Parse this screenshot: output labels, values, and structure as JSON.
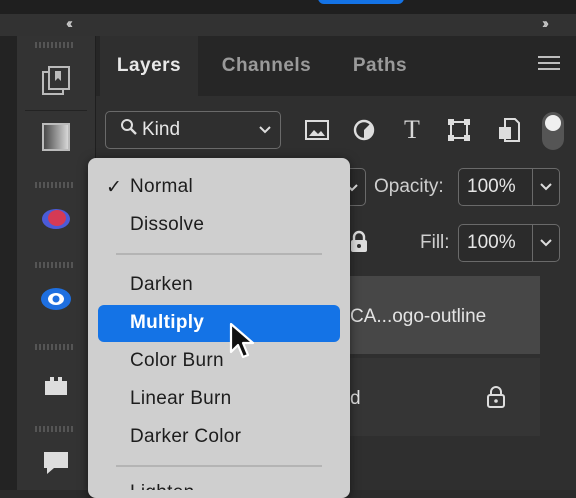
{
  "panel": {
    "collapse_left": "‹‹",
    "collapse_right": "››",
    "tabs": [
      "Layers",
      "Channels",
      "Paths"
    ],
    "active_tab": "Layers"
  },
  "filter": {
    "kind_label": "Kind",
    "icons": [
      "image-filter-icon",
      "adjustment-filter-icon",
      "type-filter-icon",
      "shape-filter-icon",
      "smart-object-filter-icon",
      "filter-toggle-icon"
    ]
  },
  "blend": {
    "opacity_label": "Opacity:",
    "opacity_value": "100%",
    "fill_label": "Fill:",
    "fill_value": "100%"
  },
  "layers": [
    {
      "name": "CA...ogo-outline"
    },
    {
      "name": "d"
    }
  ],
  "blend_menu": {
    "checkmark": "✓",
    "items": [
      "Normal",
      "Dissolve",
      "Darken",
      "Multiply",
      "Color Burn",
      "Linear Burn",
      "Darker Color",
      "Lighten"
    ],
    "selected": "Normal",
    "highlighted": "Multiply"
  },
  "colors": {
    "accent": "#1473e6",
    "menu_bg": "#cfcfcf",
    "panel_bg": "#2f2f2f"
  }
}
